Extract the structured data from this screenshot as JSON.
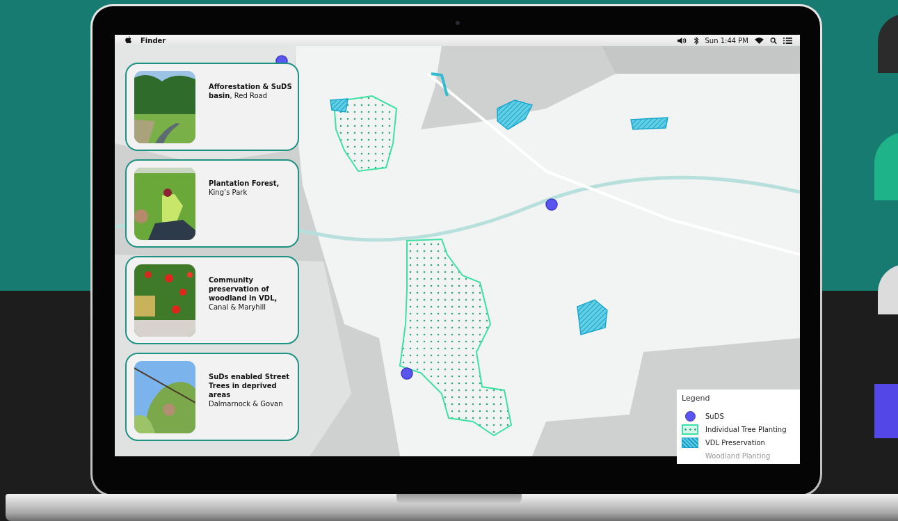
{
  "menu_bar": {
    "app": "Finder",
    "clock": "Sun 1:44 PM"
  },
  "cards": [
    {
      "kind": "inline",
      "text": "**Afforestation  & SuDS basin**, Red Road"
    },
    {
      "kind": "stacked",
      "title": "Plantation Forest,",
      "place": "King’s Park"
    },
    {
      "kind": "stacked",
      "title": "Community preservation of woodland in VDL,",
      "place": "Canal & Maryhill"
    },
    {
      "kind": "stacked",
      "title": "SuDs enabled Street Trees in deprived areas",
      "place": "Dalmarnock & Govan"
    }
  ],
  "legend": {
    "title": "Legend",
    "items": [
      {
        "kind": "dot",
        "label": "SuDS"
      },
      {
        "kind": "dotted",
        "label": "Individual Tree Planting"
      },
      {
        "kind": "hatched",
        "label": "VDL Preservation"
      },
      {
        "kind": "plain",
        "label": "Woodland Planting"
      }
    ]
  }
}
